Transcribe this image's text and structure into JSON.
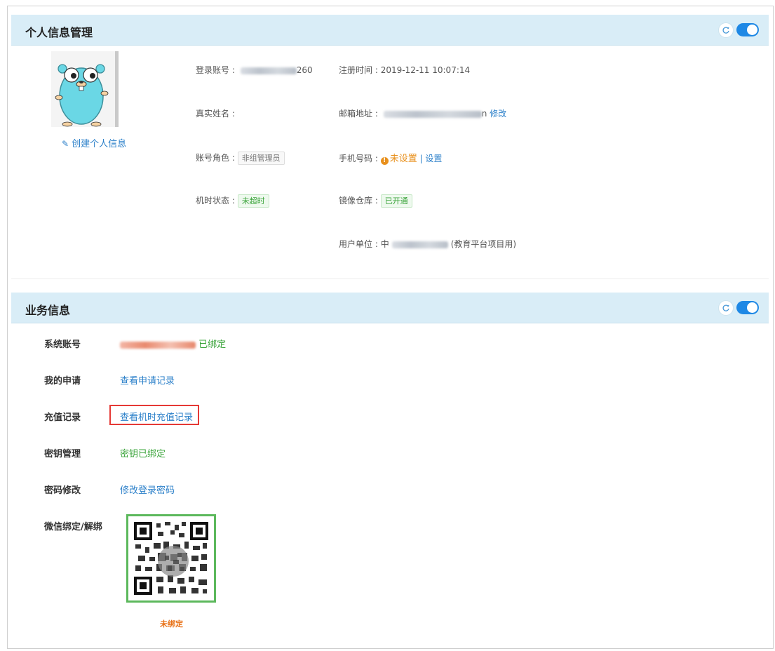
{
  "personal": {
    "title": "个人信息管理",
    "create_info_label": "创建个人信息",
    "fields": {
      "login_label": "登录账号 :",
      "login_suffix": "260",
      "register_label": "注册时间 :",
      "register_value": "2019-12-11 10:07:14",
      "realname_label": "真实姓名 :",
      "email_label": "邮箱地址 :",
      "email_suffix": "n",
      "email_edit": "修改",
      "role_label": "账号角色 :",
      "role_value": "非组管理员",
      "phone_label": "手机号码 :",
      "phone_status": "未设置",
      "phone_sep": "|",
      "phone_set": "设置",
      "time_label": "机时状态 :",
      "time_value": "未超时",
      "repo_label": "镜像仓库 :",
      "repo_value": "已开通",
      "unit_label": "用户单位 :",
      "unit_prefix": "中",
      "unit_suffix": "(教育平台项目用)"
    }
  },
  "business": {
    "title": "业务信息",
    "rows": {
      "system_account_label": "系统账号",
      "system_account_status": "已绑定",
      "my_apply_label": "我的申请",
      "my_apply_link": "查看申请记录",
      "recharge_label": "充值记录",
      "recharge_link": "查看机时充值记录",
      "key_label": "密钥管理",
      "key_status": "密钥已绑定",
      "pwd_label": "密码修改",
      "pwd_link": "修改登录密码",
      "wechat_label": "微信绑定/解绑",
      "wechat_status": "未绑定"
    }
  },
  "icons": {
    "avatar": "gopher-avatar",
    "edit": "pencil-icon",
    "refresh": "refresh-icon",
    "toggle": "toggle-switch",
    "warning": "warning-icon",
    "qr": "wechat-qr-code"
  },
  "colors": {
    "header_bg": "#d9edf7",
    "link": "#2a7fc9",
    "green": "#3aa43a",
    "orange": "#e8731a",
    "highlight_red": "#e53935",
    "qr_border": "#5cb85c",
    "toggle": "#1e88e5"
  }
}
